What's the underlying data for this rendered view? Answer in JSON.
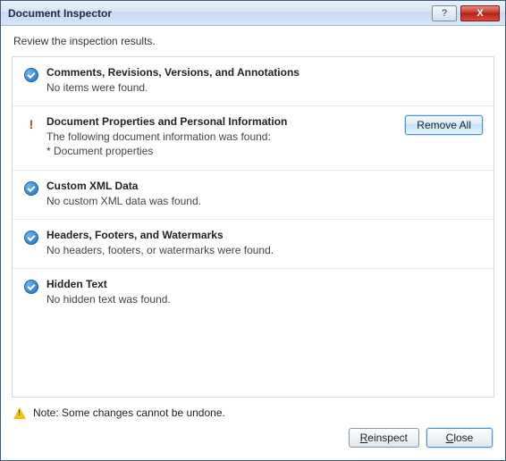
{
  "window": {
    "title": "Document Inspector",
    "help_btn": "?",
    "close_btn": "X"
  },
  "instruction": "Review the inspection results.",
  "sections": [
    {
      "icon": "check",
      "title": "Comments, Revisions, Versions, and Annotations",
      "detail": "No items were found."
    },
    {
      "icon": "exclaim",
      "title": "Document Properties and Personal Information",
      "detail": "The following document information was found:\n* Document properties",
      "action_label": "Remove All"
    },
    {
      "icon": "check",
      "title": "Custom XML Data",
      "detail": "No custom XML data was found."
    },
    {
      "icon": "check",
      "title": "Headers, Footers, and Watermarks",
      "detail": "No headers, footers, or watermarks were found."
    },
    {
      "icon": "check",
      "title": "Hidden Text",
      "detail": "No hidden text was found."
    }
  ],
  "footer": {
    "note": "Note: Some changes cannot be undone.",
    "reinspect_label": "Reinspect",
    "close_label": "Close"
  }
}
